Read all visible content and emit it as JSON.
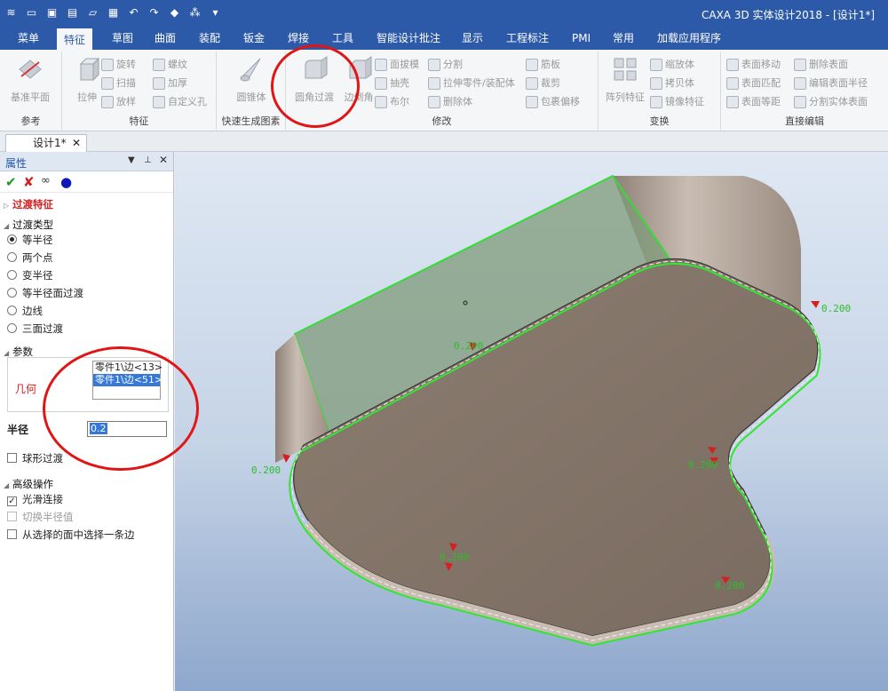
{
  "app": {
    "title": "CAXA 3D 实体设计2018 - [设计1*]"
  },
  "menu": {
    "tabs": [
      "菜单",
      "特征",
      "草图",
      "曲面",
      "装配",
      "钣金",
      "焊接",
      "工具",
      "智能设计批注",
      "显示",
      "工程标注",
      "PMI",
      "常用",
      "加载应用程序"
    ],
    "active": "特征"
  },
  "ribbon": {
    "groups": {
      "reference": {
        "label": "参考",
        "plane": "基准平面"
      },
      "feature": {
        "label": "特征",
        "extrude": "拉伸",
        "revolve": "旋转",
        "sweep": "扫描",
        "loft": "放样",
        "thread": "螺纹",
        "thicken": "加厚",
        "custom_hole": "自定义孔"
      },
      "quick": {
        "label": "快速生成图素",
        "cone": "圆锥体"
      },
      "modify": {
        "label": "修改",
        "fillet": "圆角过渡",
        "chamfer": "边倒角",
        "draft": "面拔模",
        "shell": "抽壳",
        "boolean": "布尔",
        "split": "分割",
        "pull_to_assembly": "拉伸零件/装配体",
        "delete_body": "删除体",
        "rib": "筋板",
        "trim": "裁剪",
        "wrap_offset": "包裹偏移"
      },
      "transform": {
        "label": "变换",
        "pattern": "阵列特征",
        "scale": "缩放体",
        "copy": "拷贝体",
        "mirror": "镜像特征"
      },
      "direct": {
        "label": "直接编辑",
        "move_face": "表面移动",
        "match_face": "表面匹配",
        "offset_face": "表面等距",
        "delete_face": "删除表面",
        "edit_radius": "编辑表面半径",
        "split_solid": "分割实体表面"
      }
    }
  },
  "document": {
    "tab": "设计1*"
  },
  "panel": {
    "title": "属性",
    "section_fillet": "过渡特征",
    "section_type": "过渡类型",
    "types": [
      "等半径",
      "两个点",
      "变半径",
      "等半径面过渡",
      "边线",
      "三面过渡"
    ],
    "selected_type": "等半径",
    "section_params": "参数",
    "geometry_label": "几何",
    "geometry_items": [
      "零件1\\边<13>",
      "零件1\\边<51>"
    ],
    "radius_label": "半径",
    "radius_value": "0.2",
    "spherical": "球形过渡",
    "section_advanced": "高级操作",
    "smooth": "光滑连接",
    "switch_radius": "切换半径值",
    "select_edge": "从选择的面中选择一条边"
  },
  "viewport": {
    "dim_labels": [
      "0.200",
      "0.200",
      "0.200",
      "0.200",
      "0.200",
      "0.200",
      "0.200"
    ]
  }
}
